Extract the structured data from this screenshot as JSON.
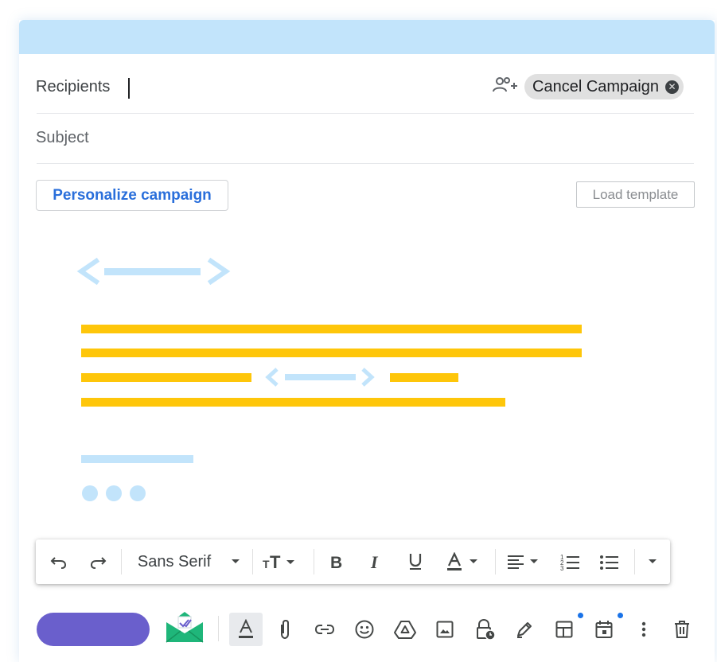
{
  "compose": {
    "recipients_label": "Recipients",
    "subject_label": "Subject",
    "chip_label": "Cancel Campaign",
    "chip_close_glyph": "✕",
    "add_people_icon": "person-add-icon",
    "personalize_label": "Personalize campaign",
    "load_template_label": "Load template"
  },
  "format_toolbar": {
    "font_name": "Sans Serif",
    "icons": [
      "undo-icon",
      "redo-icon",
      "font-size-icon",
      "bold-icon",
      "italic-icon",
      "underline-icon",
      "text-color-icon",
      "align-icon",
      "numbered-list-icon",
      "bulleted-list-icon",
      "more-formatting-icon"
    ]
  },
  "bottom_toolbar": {
    "icons": [
      "campaign-logo-icon",
      "formatting-options-icon",
      "attach-icon",
      "link-icon",
      "emoji-icon",
      "drive-icon",
      "photo-icon",
      "confidential-icon",
      "signature-icon",
      "layouts-icon",
      "schedule-icon",
      "more-options-icon",
      "delete-icon"
    ]
  },
  "colors": {
    "titlebar": "#c2e4fb",
    "accent_blue": "#2a6fdb",
    "send_button": "#6a5fcc",
    "placeholder_yellow": "#fec60a",
    "placeholder_lightblue": "#c2e4fb",
    "notification_dot": "#1a73e8"
  }
}
